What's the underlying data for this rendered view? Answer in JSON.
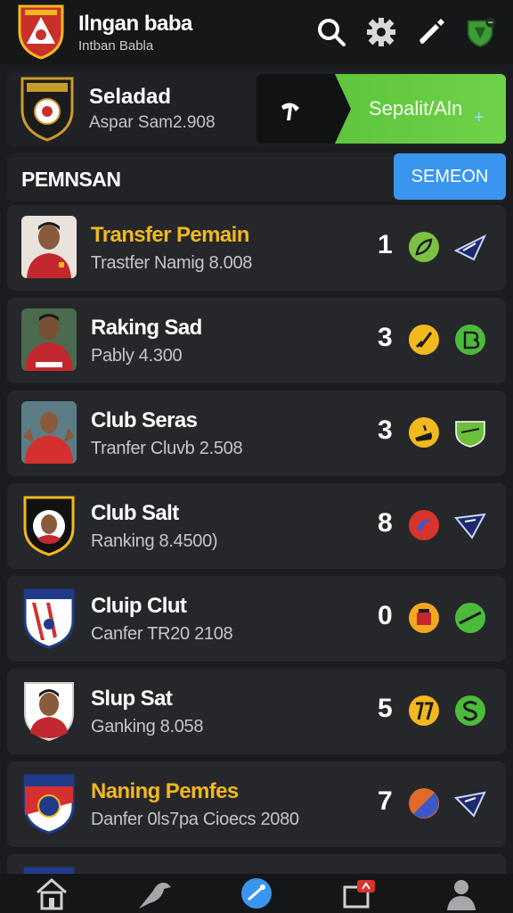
{
  "header": {
    "title": "Ilngan baba",
    "subtitle": "Intban Babla",
    "icons": [
      "search-icon",
      "gear-icon",
      "edit-icon",
      "shield-icon"
    ]
  },
  "club": {
    "name": "Seladad",
    "subtitle": "Aspar Sam2.908",
    "cta_label": "Sepalit/Aln",
    "cta_plus": "+"
  },
  "section": {
    "title": "PEMNSAN",
    "button_label": "SEMEON"
  },
  "rows": [
    {
      "title": "Transfer Pemain",
      "subtitle": "Trastfer Namig 8.008",
      "number": "1",
      "highlight": true,
      "badge1_color": "#7cc242",
      "badge2_color": "#1e2a6e"
    },
    {
      "title": "Raking Sad",
      "subtitle": "Pably 4.300",
      "number": "3",
      "highlight": false,
      "badge1_color": "#f2b81f",
      "badge2_color": "#4cbb3a"
    },
    {
      "title": "Club Seras",
      "subtitle": "Tranfer Cluvb 2.508",
      "number": "3",
      "highlight": false,
      "badge1_color": "#f2b81f",
      "badge2_color": "#6bbf3a"
    },
    {
      "title": "Club Salt",
      "subtitle": "Ranking 8.4500)",
      "number": "8",
      "highlight": false,
      "badge1_color": "#d7342d",
      "badge2_color": "#1e2a6e"
    },
    {
      "title": "Cluip Clut",
      "subtitle": "Canfer TR20 2108",
      "number": "0",
      "highlight": false,
      "badge1_color": "#f2a81f",
      "badge2_color": "#4cbb3a"
    },
    {
      "title": "Slup Sat",
      "subtitle": "Ganking 8.058",
      "number": "5",
      "highlight": false,
      "badge1_color": "#f2b81f",
      "badge2_color": "#4cbb3a"
    },
    {
      "title": "Naning Pemfes",
      "subtitle": "Danfer 0ls7pa Cioecs 2080",
      "number": "7",
      "highlight": true,
      "badge1_color": "#e26a2a",
      "badge2_color": "#1e2a6e"
    },
    {
      "title": "",
      "subtitle": "",
      "number": "",
      "highlight": false,
      "badge1_color": "#f2b81f",
      "badge2_color": "#4cbb3a"
    }
  ],
  "bottom_nav": [
    "home-icon",
    "bird-icon",
    "action-icon",
    "inbox-icon",
    "profile-icon"
  ]
}
